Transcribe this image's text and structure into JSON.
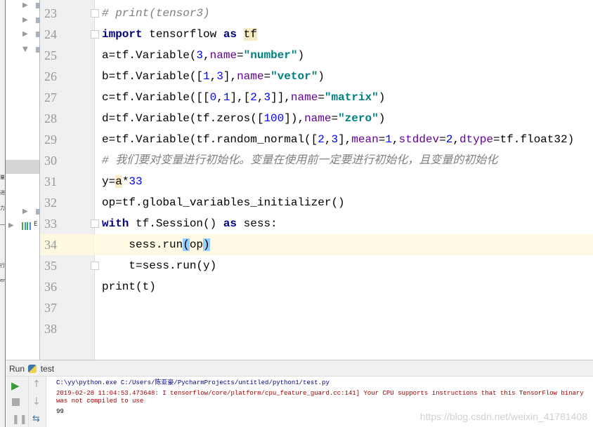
{
  "left_panel": {
    "cjk_fragments": [
      "量",
      "进",
      "力",
      "一",
      "行",
      "er"
    ],
    "tree_label": "E"
  },
  "editor": {
    "lines": [
      {
        "n": "23",
        "tokens": [
          {
            "t": "# print(tensor3)",
            "c": "cm"
          }
        ]
      },
      {
        "n": "24",
        "tokens": [
          {
            "t": "import",
            "c": "kw"
          },
          {
            "t": " tensorflow "
          },
          {
            "t": "as",
            "c": "kw"
          },
          {
            "t": " "
          },
          {
            "t": "tf",
            "c": "hl"
          }
        ]
      },
      {
        "n": "25",
        "tokens": [
          {
            "t": "a=tf.Variable("
          },
          {
            "t": "3",
            "c": "num"
          },
          {
            "t": ","
          },
          {
            "t": "name",
            "c": "kwarg"
          },
          {
            "t": "="
          },
          {
            "t": "\"number\"",
            "c": "str"
          },
          {
            "t": ")"
          }
        ]
      },
      {
        "n": "26",
        "tokens": [
          {
            "t": "b=tf.Variable(["
          },
          {
            "t": "1",
            "c": "num"
          },
          {
            "t": ","
          },
          {
            "t": "3",
            "c": "num"
          },
          {
            "t": "],"
          },
          {
            "t": "name",
            "c": "kwarg"
          },
          {
            "t": "="
          },
          {
            "t": "\"vetor\"",
            "c": "str"
          },
          {
            "t": ")"
          }
        ]
      },
      {
        "n": "27",
        "tokens": [
          {
            "t": "c=tf.Variable([["
          },
          {
            "t": "0",
            "c": "num"
          },
          {
            "t": ","
          },
          {
            "t": "1",
            "c": "num"
          },
          {
            "t": "],["
          },
          {
            "t": "2",
            "c": "num"
          },
          {
            "t": ","
          },
          {
            "t": "3",
            "c": "num"
          },
          {
            "t": "]],"
          },
          {
            "t": "name",
            "c": "kwarg"
          },
          {
            "t": "="
          },
          {
            "t": "\"matrix\"",
            "c": "str"
          },
          {
            "t": ")"
          }
        ]
      },
      {
        "n": "28",
        "tokens": [
          {
            "t": "d=tf.Variable(tf.zeros(["
          },
          {
            "t": "100",
            "c": "num"
          },
          {
            "t": "]),"
          },
          {
            "t": "name",
            "c": "kwarg"
          },
          {
            "t": "="
          },
          {
            "t": "\"zero\"",
            "c": "str"
          },
          {
            "t": ")"
          }
        ]
      },
      {
        "n": "29",
        "tokens": [
          {
            "t": "e=tf.Variable(tf.random_normal(["
          },
          {
            "t": "2",
            "c": "num"
          },
          {
            "t": ","
          },
          {
            "t": "3",
            "c": "num"
          },
          {
            "t": "],"
          },
          {
            "t": "mean",
            "c": "kwarg"
          },
          {
            "t": "="
          },
          {
            "t": "1",
            "c": "num"
          },
          {
            "t": ","
          },
          {
            "t": "stddev",
            "c": "kwarg"
          },
          {
            "t": "="
          },
          {
            "t": "2",
            "c": "num"
          },
          {
            "t": ","
          },
          {
            "t": "dtype",
            "c": "kwarg"
          },
          {
            "t": "=tf.float32)"
          }
        ]
      },
      {
        "n": "30",
        "tokens": [
          {
            "t": "# 我们要对变量进行初始化。变量在使用前一定要进行初始化，且变量的初始化",
            "c": "cm"
          }
        ]
      },
      {
        "n": "31",
        "tokens": [
          {
            "t": "y="
          },
          {
            "t": "a",
            "c": "hl"
          },
          {
            "t": "*"
          },
          {
            "t": "33",
            "c": "num"
          }
        ]
      },
      {
        "n": "32",
        "tokens": [
          {
            "t": "op=tf.global_variables_initializer()"
          }
        ]
      },
      {
        "n": "33",
        "tokens": [
          {
            "t": "with",
            "c": "kw"
          },
          {
            "t": " tf.Session() "
          },
          {
            "t": "as",
            "c": "kw"
          },
          {
            "t": " sess:"
          }
        ]
      },
      {
        "n": "34",
        "current": true,
        "tokens": [
          {
            "t": "    sess.run"
          },
          {
            "t": "(",
            "c": "br"
          },
          {
            "t": "op"
          },
          {
            "t": ")",
            "c": "br"
          }
        ]
      },
      {
        "n": "35",
        "tokens": [
          {
            "t": "    t=sess.run(y)"
          }
        ]
      },
      {
        "n": "36",
        "tokens": [
          {
            "t": "print(t)"
          }
        ]
      },
      {
        "n": "37",
        "tokens": []
      },
      {
        "n": "38",
        "tokens": []
      }
    ]
  },
  "run": {
    "label": "Run",
    "config": "test"
  },
  "console": {
    "lines": [
      {
        "text": "C:\\yy\\python.exe C:/Users/陈亚豪/PycharmProjects/untitled/python1/test.py",
        "color": "#000080"
      },
      {
        "text": "2019-02-28 11:04:53.473648: I tensorflow/core/platform/cpu_feature_guard.cc:141] Your CPU supports instructions that this TensorFlow binary was not compiled to use",
        "color": "#a00000"
      },
      {
        "text": "99",
        "color": "#000000"
      }
    ],
    "watermark": "https://blog.csdn.net/weixin_41781408"
  }
}
